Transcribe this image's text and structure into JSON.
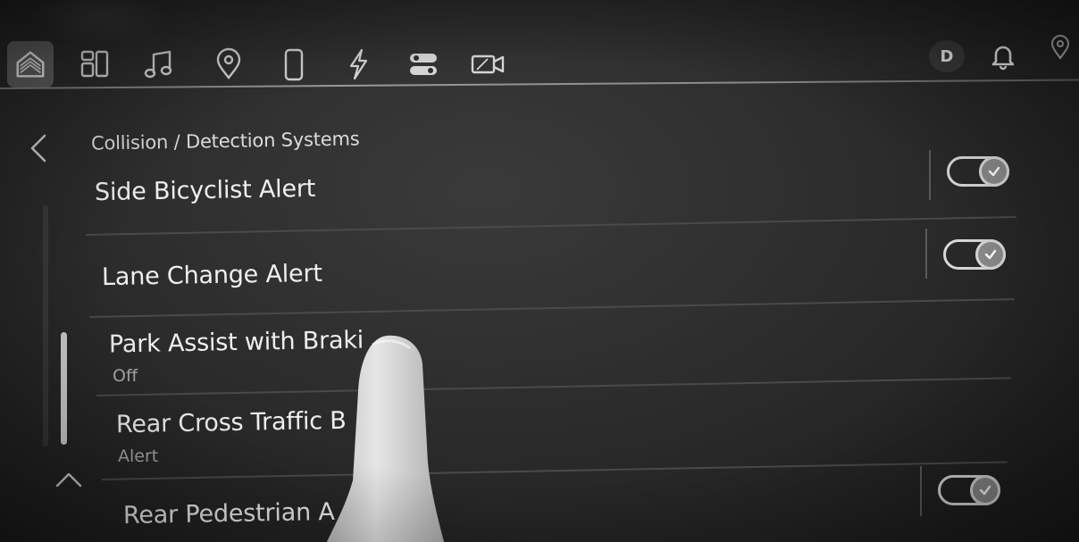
{
  "topbar": {
    "icons": [
      "home-icon",
      "apps-grid-icon",
      "music-note-icon",
      "location-pin-icon",
      "phone-icon",
      "energy-bolt-icon",
      "vehicle-controls-icon",
      "camera-icon"
    ],
    "driver_initial": "D",
    "notification_icon": "bell-icon",
    "nav_status_icon": "location-pin-icon"
  },
  "header": {
    "breadcrumb": "Collision / Detection Systems"
  },
  "settings": [
    {
      "label": "Side Bicyclist Alert",
      "toggle": true
    },
    {
      "label": "Lane Change Alert",
      "toggle": true
    },
    {
      "label": "Park Assist with Braki",
      "sublabel": "Off"
    },
    {
      "label": "Rear Cross Traffic B",
      "sublabel": "Alert"
    },
    {
      "label": "Rear Pedestrian A",
      "toggle": true
    }
  ],
  "colors": {
    "background": "#2e2e2e",
    "text": "#efefef",
    "subtext": "#a9a9a9",
    "toggle_on": "#8a8a8a"
  }
}
